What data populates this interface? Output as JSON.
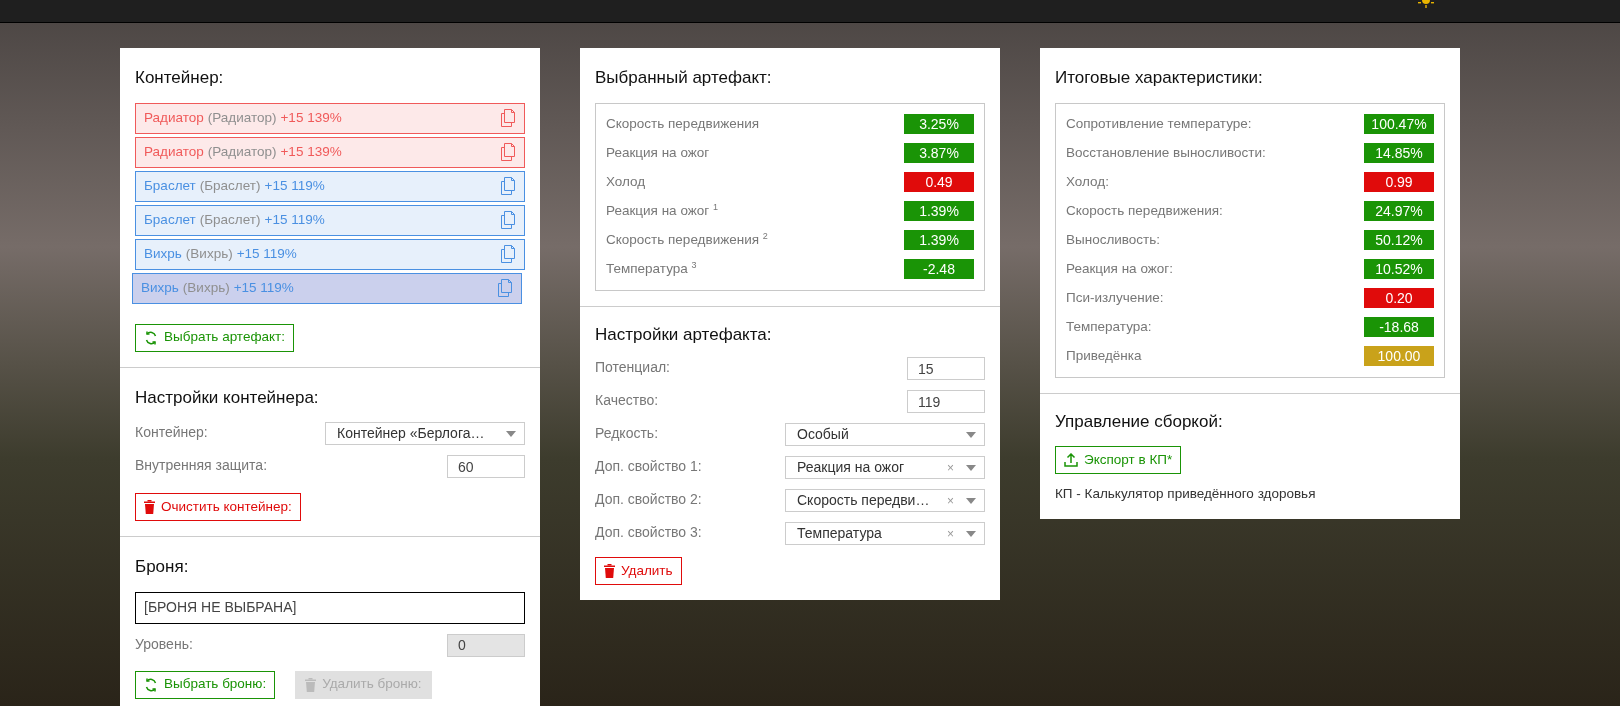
{
  "container": {
    "title": "Контейнер:",
    "artifacts": [
      {
        "name": "Радиатор",
        "base": "(Радиатор)",
        "stats": "+15 139%",
        "color": "#f05a5a",
        "selected": false
      },
      {
        "name": "Радиатор",
        "base": "(Радиатор)",
        "stats": "+15 139%",
        "color": "#f05a5a",
        "selected": false
      },
      {
        "name": "Браслет",
        "base": "(Браслет)",
        "stats": "+15 119%",
        "color": "#4a90e2",
        "selected": false
      },
      {
        "name": "Браслет",
        "base": "(Браслет)",
        "stats": "+15 119%",
        "color": "#4a90e2",
        "selected": false
      },
      {
        "name": "Вихрь",
        "base": "(Вихрь)",
        "stats": "+15 119%",
        "color": "#4a90e2",
        "selected": false
      },
      {
        "name": "Вихрь",
        "base": "(Вихрь)",
        "stats": "+15 119%",
        "color": "#4a90e2",
        "selected": true
      }
    ],
    "pick_button": "Выбрать артефакт:"
  },
  "container_settings": {
    "title": "Настройки контейнера:",
    "fields": [
      {
        "label": "Контейнер:",
        "kind": "select",
        "value": "Контейнер «Берлога…"
      },
      {
        "label": "Внутренняя защита:",
        "kind": "input",
        "value": "60",
        "disabled": false
      }
    ],
    "clear_button": "Очистить контейнер:"
  },
  "armor": {
    "title": "Броня:",
    "selected_armor": "[БРОНЯ НЕ ВЫБРАНА]",
    "fields": [
      {
        "label": "Уровень:",
        "kind": "input",
        "value": "0",
        "disabled": true
      }
    ],
    "pick_button": "Выбрать броню:",
    "remove_button": {
      "label": "Удалить броню:",
      "disabled": true
    }
  },
  "selected_artifact": {
    "title": "Выбранный артефакт:",
    "stats": [
      {
        "label": "Скорость передвижения",
        "value": "3.25%",
        "color": "#1a9406"
      },
      {
        "label": "Реакция на ожог",
        "value": "3.87%",
        "color": "#1a9406"
      },
      {
        "label": "Холод",
        "value": "0.49",
        "color": "#e00b0b"
      },
      {
        "label": "Реакция на ожог $^{1}$",
        "value": "1.39%",
        "color": "#1a9406"
      },
      {
        "label": "Скорость передвижения $^{2}$",
        "value": "1.39%",
        "color": "#1a9406"
      },
      {
        "label": "Температура $^{3}$",
        "value": "-2.48",
        "color": "#1a9406"
      }
    ]
  },
  "artifact_settings": {
    "title": "Настройки артефакта:",
    "fields": [
      {
        "label": "Потенциал:",
        "kind": "input",
        "value": "15",
        "disabled": false
      },
      {
        "label": "Качество:",
        "kind": "input",
        "value": "119",
        "disabled": false
      },
      {
        "label": "Редкость:",
        "kind": "select",
        "value": "Особый"
      },
      {
        "label": "Доп. свойство 1:",
        "kind": "select",
        "value": "Реакция на ожог",
        "clear": "×"
      },
      {
        "label": "Доп. свойство 2:",
        "kind": "select",
        "value": "Скорость передви…",
        "clear": "×"
      },
      {
        "label": "Доп. свойство 3:",
        "kind": "select",
        "value": "Температура",
        "clear": "×"
      }
    ],
    "delete_button": "Удалить"
  },
  "totals": {
    "title": "Итоговые характеристики:",
    "stats": [
      {
        "label": "Сопротивление температуре:",
        "value": "100.47%",
        "color": "#1a9406"
      },
      {
        "label": "Восстановление выносливости:",
        "value": "14.85%",
        "color": "#1a9406"
      },
      {
        "label": "Холод:",
        "value": "0.99",
        "color": "#e00b0b"
      },
      {
        "label": "Скорость передвижения:",
        "value": "24.97%",
        "color": "#1a9406"
      },
      {
        "label": "Выносливость:",
        "value": "50.12%",
        "color": "#1a9406"
      },
      {
        "label": "Реакция на ожог:",
        "value": "10.52%",
        "color": "#1a9406"
      },
      {
        "label": "Пси-излучение:",
        "value": "0.20",
        "color": "#e00b0b"
      },
      {
        "label": "Температура:",
        "value": "-18.68",
        "color": "#1a9406"
      },
      {
        "label": "Приведёнка",
        "value": "100.00",
        "color": "#c9a21a"
      }
    ]
  },
  "build": {
    "title": "Управление сборкой:",
    "export_button": "Экспорт в КП*",
    "note": "КП - Калькулятор приведённого здоровья"
  }
}
